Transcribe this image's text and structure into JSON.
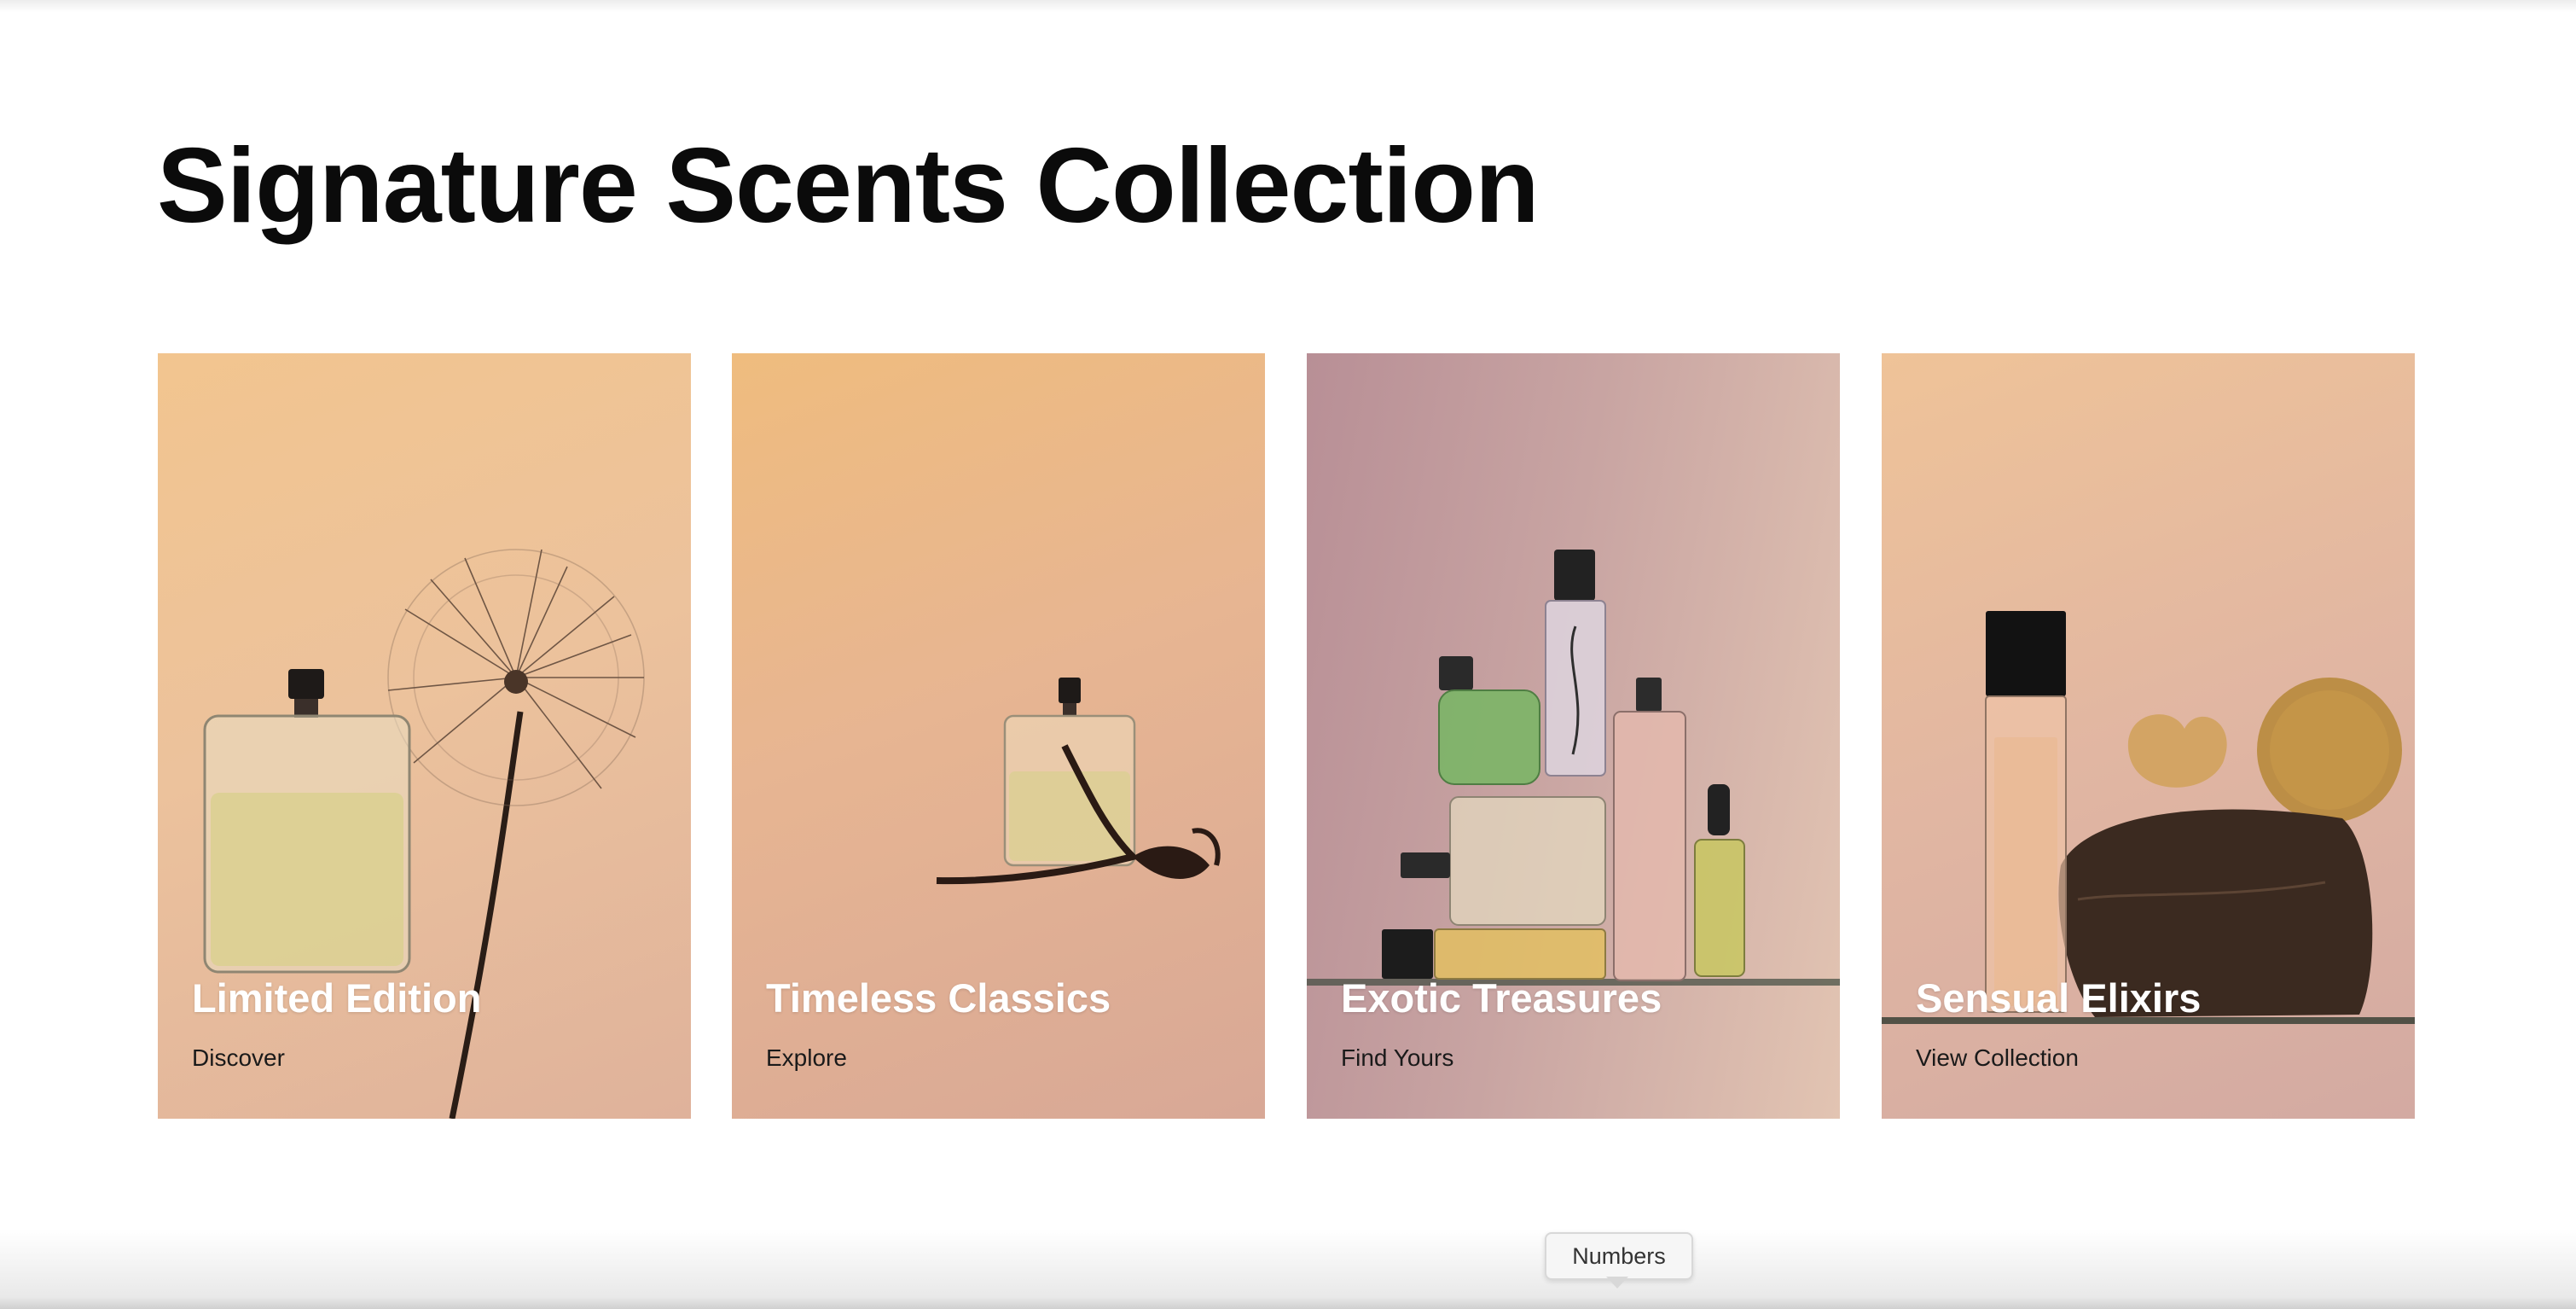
{
  "section": {
    "title": "Signature Scents Collection"
  },
  "cards": [
    {
      "title": "Limited Edition",
      "link": "Discover",
      "image_icon": "perfume-bottle-dandelion-icon"
    },
    {
      "title": "Timeless Classics",
      "link": "Explore",
      "image_icon": "perfume-bottle-flower-icon"
    },
    {
      "title": "Exotic Treasures",
      "link": "Find Yours",
      "image_icon": "perfume-bottles-group-icon"
    },
    {
      "title": "Sensual Elixirs",
      "link": "View Collection",
      "image_icon": "perfume-bottle-soil-icon"
    }
  ],
  "tooltip": {
    "label": "Numbers"
  },
  "colors": {
    "title_text": "#0b0b0b",
    "card_title": "#ffffff",
    "card_link": "#1a1a1a",
    "card_warm": "#ecc29c",
    "card_mauve": "#b88f96"
  }
}
